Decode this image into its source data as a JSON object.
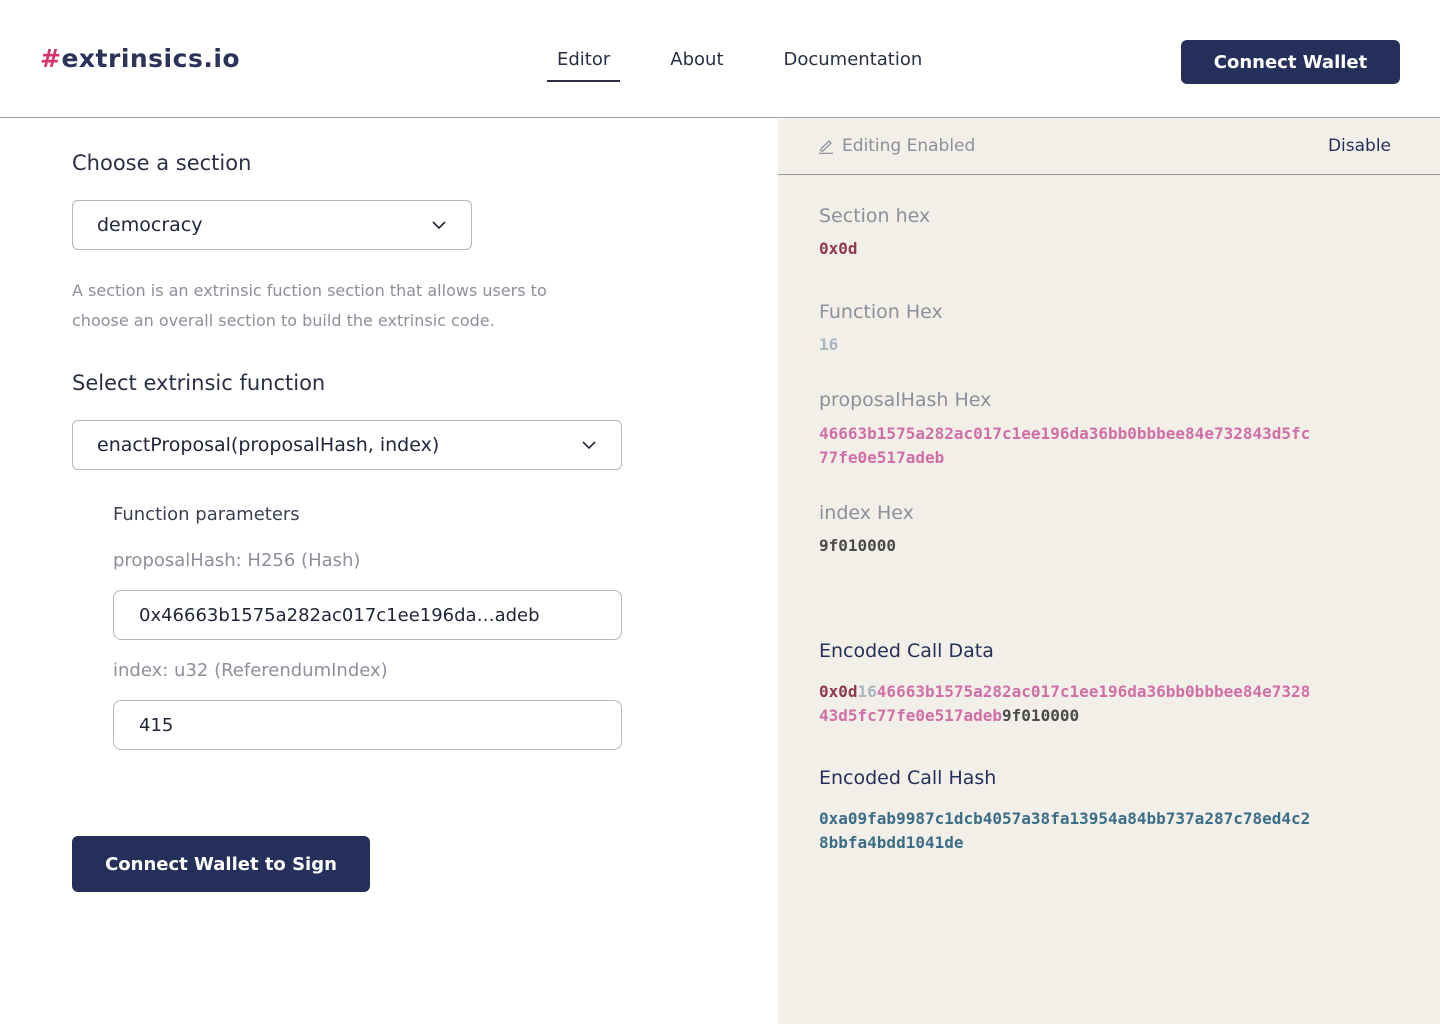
{
  "header": {
    "logo_hash": "#",
    "logo_text": "extrinsics.io",
    "nav": [
      "Editor",
      "About",
      "Documentation"
    ],
    "connect_wallet": "Connect Wallet"
  },
  "form": {
    "section_label": "Choose a section",
    "section_value": "democracy",
    "section_help": "A section is an extrinsic fuction section that allows users to choose an overall section to build the extrinsic code.",
    "function_label": "Select extrinsic function",
    "function_value": "enactProposal(proposalHash, index)",
    "params_title": "Function parameters",
    "param1_label": "proposalHash: H256 (Hash)",
    "param1_value": "0x46663b1575a282ac017c1ee196da…adeb",
    "param2_label": "index: u32 (ReferendumIndex)",
    "param2_value": "415",
    "sign_button": "Connect Wallet to Sign"
  },
  "panel": {
    "edit_status": "Editing Enabled",
    "disable": "Disable",
    "section_hex_label": "Section hex",
    "section_hex": "0x0d",
    "function_hex_label": "Function Hex",
    "function_hex": "16",
    "proposal_hex_label": "proposalHash Hex",
    "proposal_hex": "46663b1575a282ac017c1ee196da36bb0bbbee84e732843d5fc77fe0e517adeb",
    "index_hex_label": "index Hex",
    "index_hex": "9f010000",
    "encoded_data_label": "Encoded Call Data",
    "encoded_data_parts": [
      "0x0d",
      "16",
      "46663b1575a282ac017c1ee196da36bb0bbbee84e732843d5fc77fe0e517adeb",
      "9f010000"
    ],
    "encoded_hash_label": "Encoded Call Hash",
    "encoded_hash": "0xa09fab9987c1dcb4057a38fa13954a84bb737a287c78ed4c28bbfa4bdd1041de"
  },
  "colors": {
    "accent": "#25305a",
    "section_hex": "#8e3a4c",
    "function_hex": "#a9b5bf",
    "proposal_hex": "#d06fa6",
    "index_hex": "#4a4a4a",
    "call_hash": "#3b6e86"
  }
}
